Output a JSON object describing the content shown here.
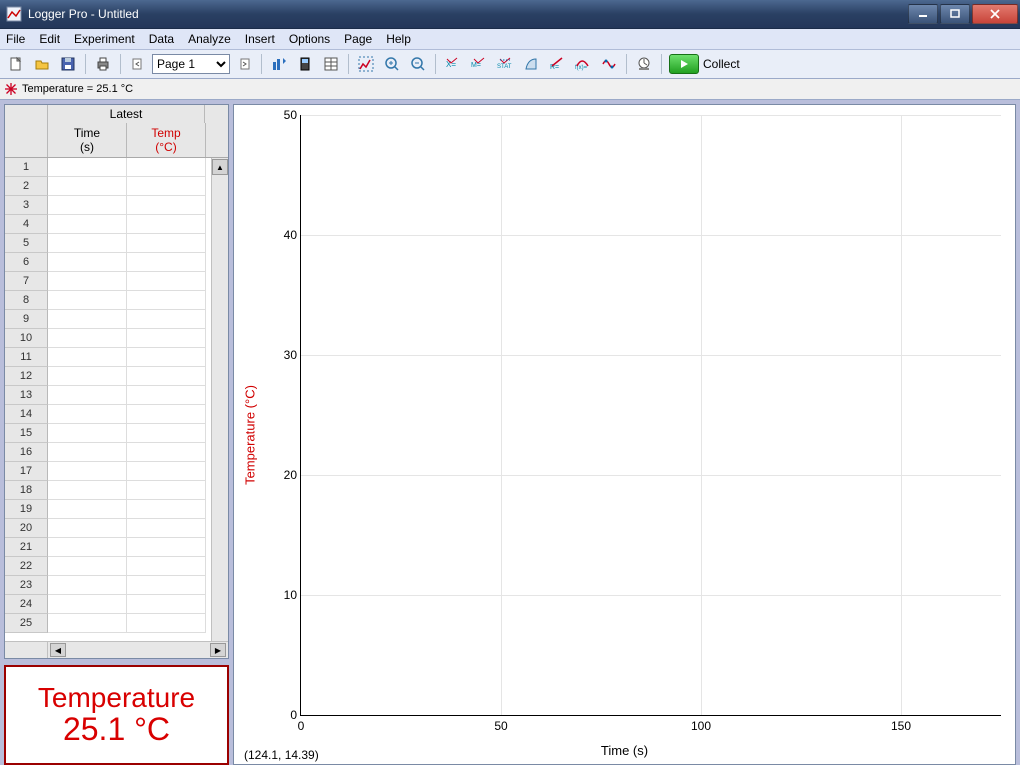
{
  "window": {
    "title": "Logger Pro - Untitled"
  },
  "menu": [
    "File",
    "Edit",
    "Experiment",
    "Data",
    "Analyze",
    "Insert",
    "Options",
    "Page",
    "Help"
  ],
  "toolbar": {
    "page_selector": "Page 1",
    "collect_label": "Collect"
  },
  "sensorbar": {
    "text": "Temperature =  25.1 °C"
  },
  "table": {
    "superheader": "Latest",
    "headers": {
      "time_label": "Time",
      "time_unit": "(s)",
      "temp_label": "Temp",
      "temp_unit": "(°C)"
    },
    "rows": 25
  },
  "meter": {
    "title": "Temperature",
    "value": "25.1 °C"
  },
  "graph": {
    "ylabel": "Temperature (°C)",
    "xlabel": "Time (s)",
    "cursor": "(124.1, 14.39)"
  },
  "chart_data": {
    "type": "line",
    "title": "",
    "xlabel": "Time (s)",
    "ylabel": "Temperature (°C)",
    "x_ticks": [
      0,
      50,
      100,
      150
    ],
    "y_ticks": [
      0,
      10,
      20,
      30,
      40,
      50
    ],
    "xlim": [
      0,
      175
    ],
    "ylim": [
      0,
      50
    ],
    "series": [
      {
        "name": "Temp",
        "x": [],
        "y": []
      }
    ]
  }
}
